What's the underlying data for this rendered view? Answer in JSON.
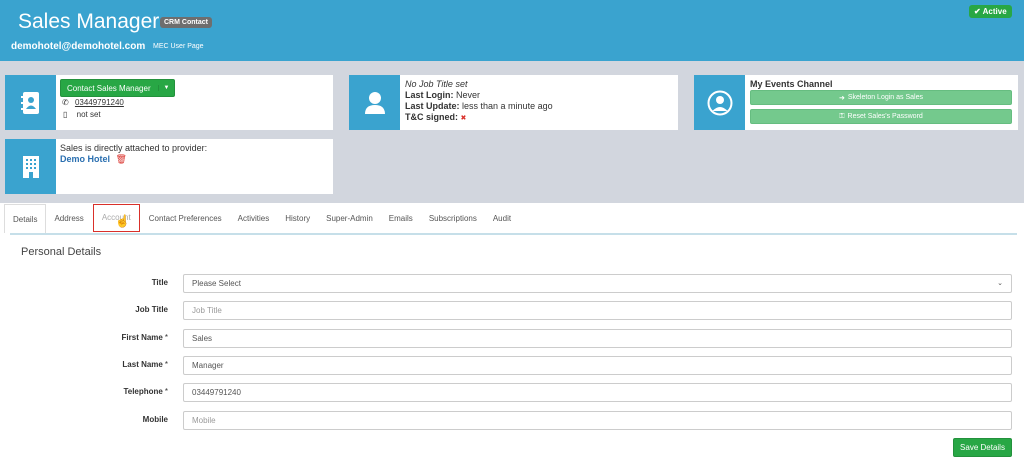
{
  "header": {
    "title": "Sales Manager",
    "badge": "CRM Contact",
    "email": "demohotel@demohotel.com",
    "mec_link": "MEC User Page",
    "status": "Active"
  },
  "contact_card": {
    "button": "Contact Sales Manager",
    "phone": "03449791240",
    "mobile": "not set"
  },
  "job_card": {
    "job_title": "No Job Title set",
    "last_login_label": "Last Login:",
    "last_login_value": "Never",
    "last_update_label": "Last Update:",
    "last_update_value": "less than a minute ago",
    "tc_label": "T&C signed:",
    "tc_value": "✖"
  },
  "events_card": {
    "title": "My Events Channel",
    "skeleton_login": "Skeleton Login as Sales",
    "reset_password": "Reset Sales's Password"
  },
  "provider_card": {
    "text": "Sales is directly attached to provider:",
    "provider": "Demo Hotel"
  },
  "tabs": [
    {
      "label": "Details"
    },
    {
      "label": "Address"
    },
    {
      "label": "Account"
    },
    {
      "label": "Contact Preferences"
    },
    {
      "label": "Activities"
    },
    {
      "label": "History"
    },
    {
      "label": "Super-Admin"
    },
    {
      "label": "Emails"
    },
    {
      "label": "Subscriptions"
    },
    {
      "label": "Audit"
    }
  ],
  "section_title": "Personal Details",
  "form": {
    "title": {
      "label": "Title",
      "value": "Please Select"
    },
    "job_title": {
      "label": "Job Title",
      "placeholder": "Job Title"
    },
    "first_name": {
      "label": "First Name",
      "value": "Sales",
      "required": "*"
    },
    "last_name": {
      "label": "Last Name",
      "value": "Manager",
      "required": "*"
    },
    "telephone": {
      "label": "Telephone",
      "value": "03449791240",
      "required": "*"
    },
    "mobile": {
      "label": "Mobile",
      "placeholder": "Mobile"
    }
  },
  "save_button": "Save Details",
  "colors": {
    "brand": "#3aa3cf",
    "success": "#28a745",
    "light_success": "#74c98d",
    "highlight": "#d9302a"
  }
}
